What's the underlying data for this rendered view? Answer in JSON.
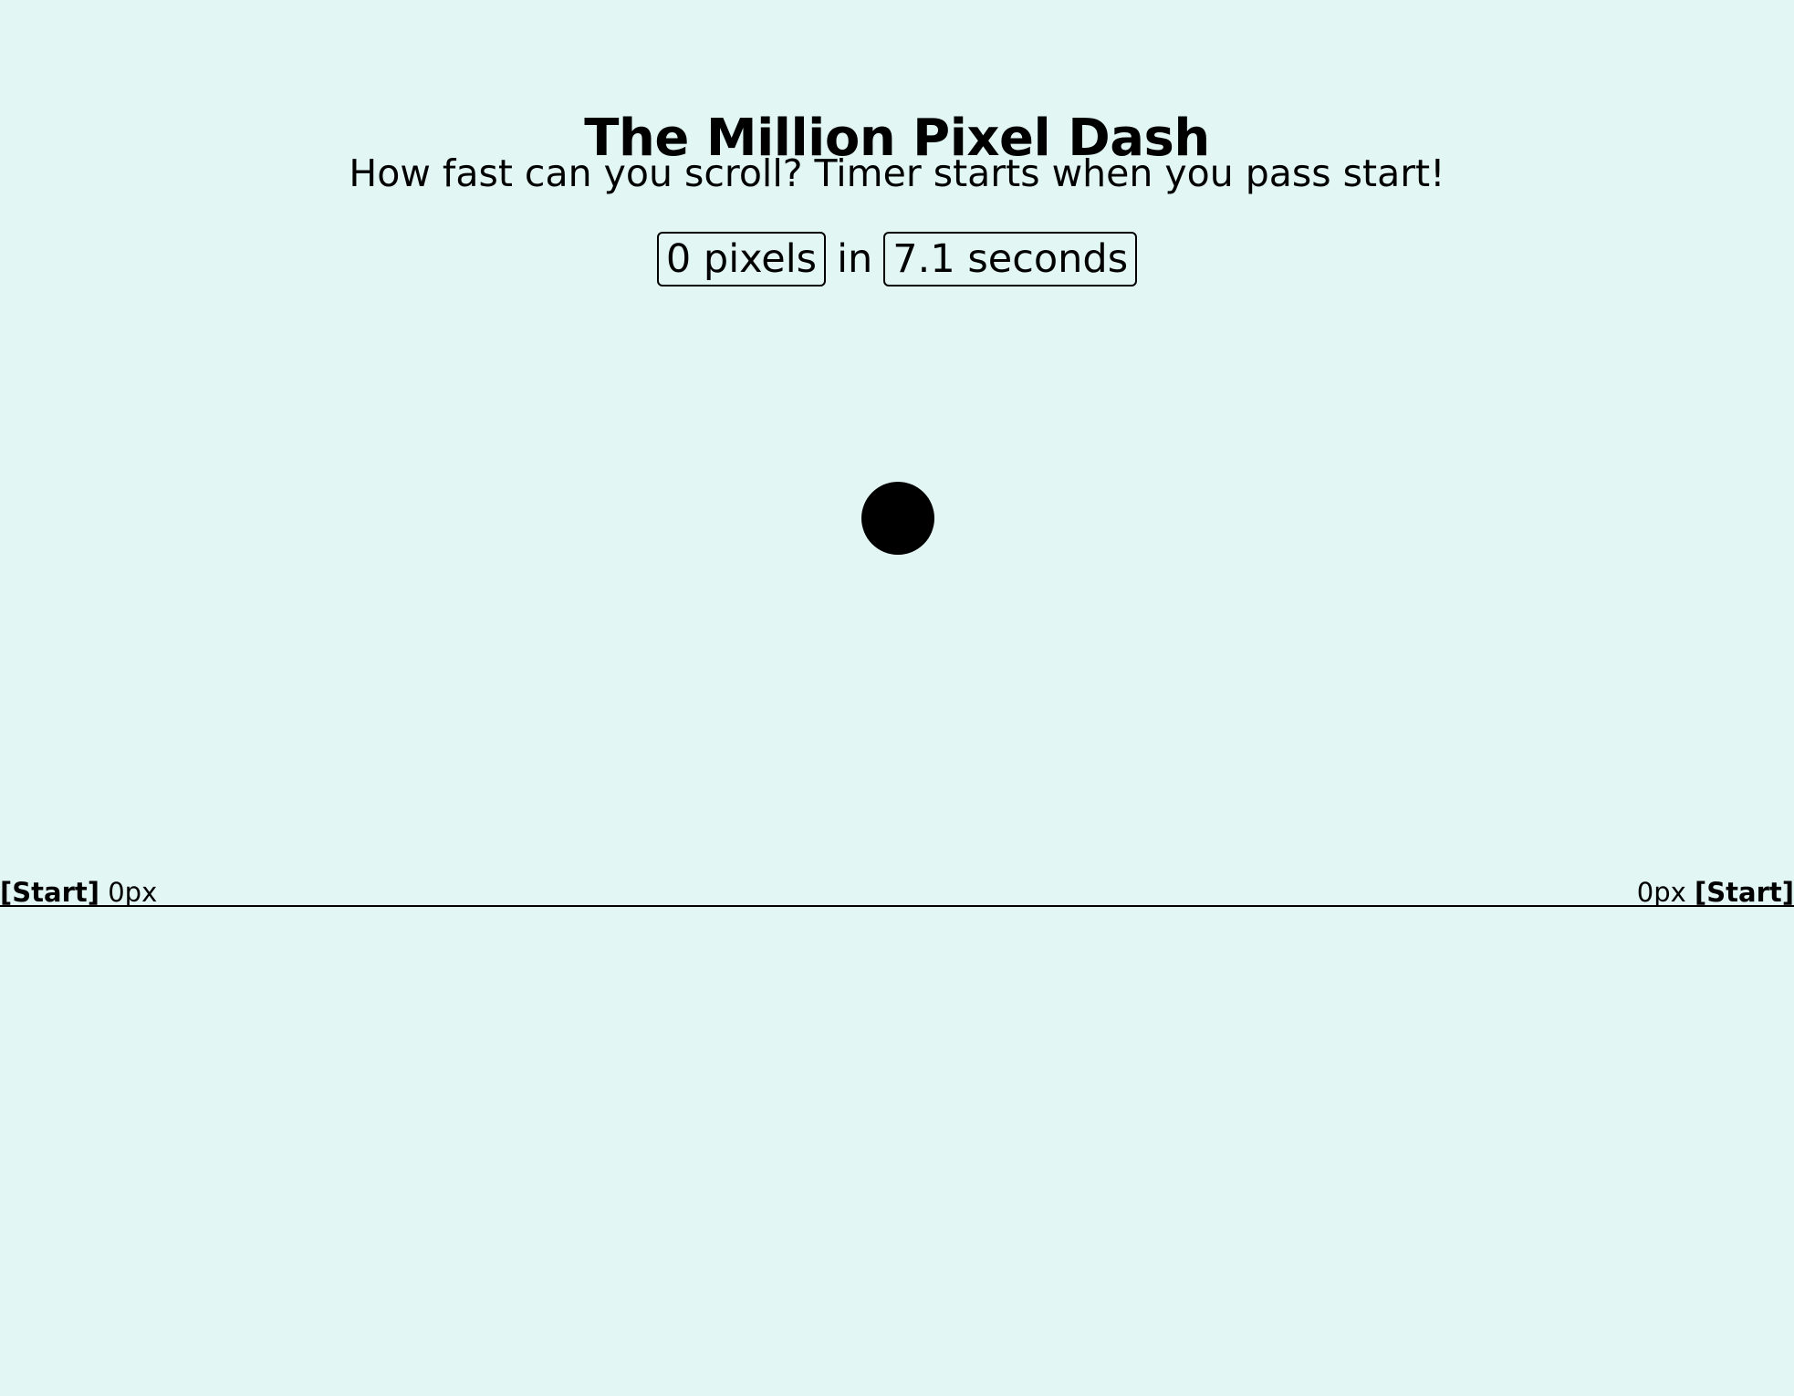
{
  "header": {
    "title": "The Million Pixel Dash",
    "subtitle": "How fast can you scroll? Timer starts when you pass start!"
  },
  "stats": {
    "pixels_text": "0 pixels",
    "connector": "in",
    "seconds_text": "7.1 seconds"
  },
  "start_marker": {
    "label": "[Start]",
    "distance": "0px"
  },
  "colors": {
    "background": "#e2f6f4",
    "foreground": "#000000"
  }
}
